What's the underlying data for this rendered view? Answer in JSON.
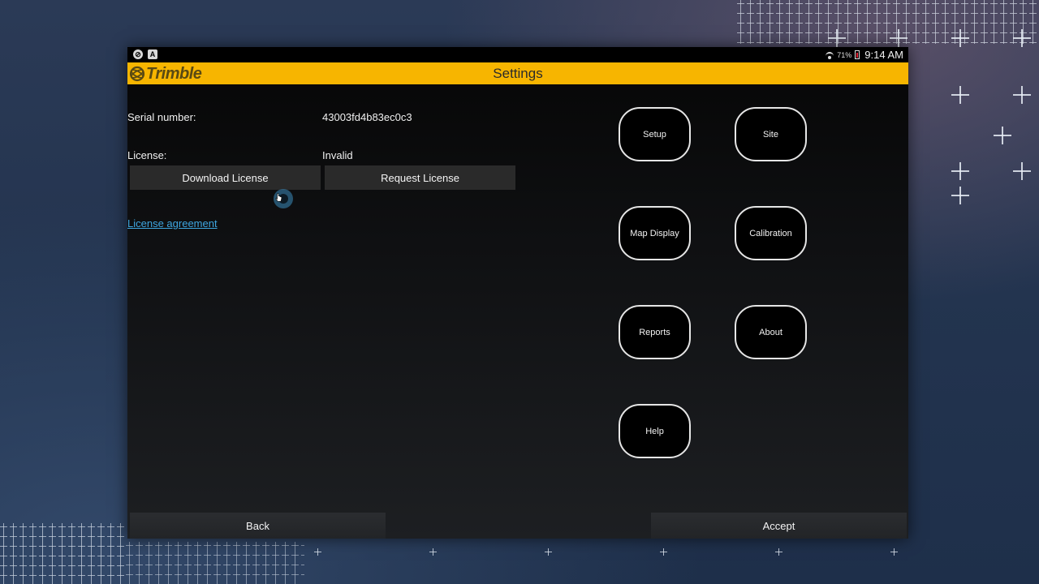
{
  "statusbar": {
    "battery_pct": "71%",
    "time": "9:14 AM"
  },
  "header": {
    "brand": "Trimble",
    "title": "Settings"
  },
  "fields": {
    "serial_label": "Serial number:",
    "serial_value": "43003fd4b83ec0c3",
    "license_label": "License:",
    "license_value": "Invalid"
  },
  "actions": {
    "download_license": "Download License",
    "request_license": "Request License",
    "license_agreement": "License agreement"
  },
  "menu": {
    "setup": "Setup",
    "site": "Site",
    "map_display": "Map Display",
    "calibration": "Calibration",
    "reports": "Reports",
    "about": "About",
    "help": "Help"
  },
  "footer": {
    "back": "Back",
    "accept": "Accept"
  },
  "colors": {
    "accent": "#f7b500",
    "link": "#3ea6e0",
    "background": "#000000"
  }
}
